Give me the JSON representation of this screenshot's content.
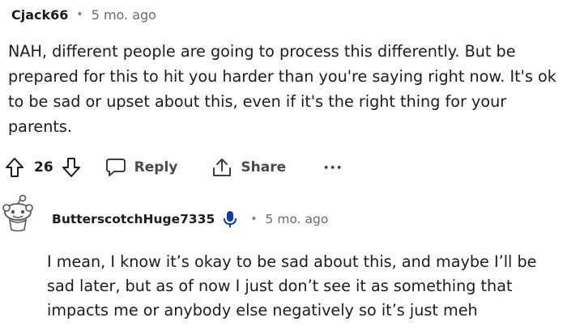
{
  "comment1": {
    "username": "Cjack66",
    "separator": "•",
    "time": "5 mo. ago",
    "body": "NAH, different people are going to process this differently. But be prepared for this to hit you harder than you're saying right now. It's ok to be sad or upset about this, even if it's the right thing for your parents.",
    "votes": "26",
    "reply_label": "Reply",
    "share_label": "Share",
    "more_label": "•••"
  },
  "comment2": {
    "username": "ButterscotchHuge7335",
    "separator": "•",
    "time": "5 mo. ago",
    "body": "I mean, I know it’s okay to be sad about this, and maybe I’ll be sad later, but as of now I just don’t see it as something that impacts me or anybody else negatively so it’s just meh",
    "badge_icon": "microphone-icon"
  },
  "colors": {
    "text": "#1c1c1c",
    "meta": "#6a6a6a",
    "badge_blue": "#0f3f9e"
  }
}
